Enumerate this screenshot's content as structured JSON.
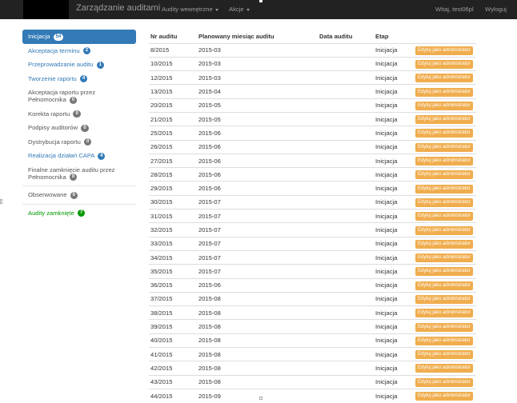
{
  "navbar": {
    "brand": "Zarządzanie auditami",
    "menu1": "Audity wewnętrzne",
    "menu2": "Akcje",
    "welcome": "Witaj, test06pl",
    "logout": "Wyloguj"
  },
  "sidebar": [
    {
      "label": "Inicjacja",
      "count": "54",
      "style": "active"
    },
    {
      "label": "Akceptacja terminu",
      "count": "2",
      "style": "blue"
    },
    {
      "label": "Przeprowadzanie auditu",
      "count": "1",
      "style": "blue"
    },
    {
      "label": "Tworzenie raportu",
      "count": "4",
      "style": "blue"
    },
    {
      "label": "Akceptacja raportu przez Pełnomocnika",
      "count": "0",
      "style": "gray"
    },
    {
      "label": "Korekta raportu",
      "count": "0",
      "style": "gray"
    },
    {
      "label": "Podpisy auditorów",
      "count": "0",
      "style": "gray"
    },
    {
      "label": "Dystrybucja raportu",
      "count": "0",
      "style": "gray"
    },
    {
      "label": "Realizacja działań CAPA",
      "count": "4",
      "style": "blue"
    },
    {
      "label": "Finalne zamknięcie auditu przez Pełnomocnika",
      "count": "0",
      "style": "gray"
    },
    {
      "label": "Obserwowane",
      "count": "0",
      "style": "gray",
      "divider_before": true
    },
    {
      "label": "Audity zamknięte",
      "count": "7",
      "style": "green",
      "divider_before": true
    }
  ],
  "table": {
    "headers": [
      "Nr auditu",
      "Planowany miesiąc auditu",
      "Data auditu",
      "Etap",
      ""
    ],
    "button_label": "Edytuj jako administrator",
    "rows": [
      [
        "8/2015",
        "2015-03",
        "",
        "Inicjacja"
      ],
      [
        "10/2015",
        "2015-03",
        "",
        "Inicjacja"
      ],
      [
        "12/2015",
        "2015-03",
        "",
        "Inicjacja"
      ],
      [
        "13/2015",
        "2015-04",
        "",
        "Inicjacja"
      ],
      [
        "20/2015",
        "2015-05",
        "",
        "Inicjacja"
      ],
      [
        "21/2015",
        "2015-05",
        "",
        "Inicjacja"
      ],
      [
        "25/2015",
        "2015-06",
        "",
        "Inicjacja"
      ],
      [
        "26/2015",
        "2015-06",
        "",
        "Inicjacja"
      ],
      [
        "27/2015",
        "2015-06",
        "",
        "Inicjacja"
      ],
      [
        "28/2015",
        "2015-06",
        "",
        "Inicjacja"
      ],
      [
        "29/2015",
        "2015-06",
        "",
        "Inicjacja"
      ],
      [
        "30/2015",
        "2015-07",
        "",
        "Inicjacja"
      ],
      [
        "31/2015",
        "2015-07",
        "",
        "Inicjacja"
      ],
      [
        "32/2015",
        "2015-07",
        "",
        "Inicjacja"
      ],
      [
        "33/2015",
        "2015-07",
        "",
        "Inicjacja"
      ],
      [
        "34/2015",
        "2015-07",
        "",
        "Inicjacja"
      ],
      [
        "35/2015",
        "2015-07",
        "",
        "Inicjacja"
      ],
      [
        "36/2015",
        "2015-06",
        "",
        "Inicjacja"
      ],
      [
        "37/2015",
        "2015-08",
        "",
        "Inicjacja"
      ],
      [
        "38/2015",
        "2015-08",
        "",
        "Inicjacja"
      ],
      [
        "39/2015",
        "2015-08",
        "",
        "Inicjacja"
      ],
      [
        "40/2015",
        "2015-08",
        "",
        "Inicjacja"
      ],
      [
        "41/2015",
        "2015-08",
        "",
        "Inicjacja"
      ],
      [
        "42/2015",
        "2015-08",
        "",
        "Inicjacja"
      ],
      [
        "43/2015",
        "2015-08",
        "",
        "Inicjacja"
      ],
      [
        "44/2015",
        "2015-09",
        "",
        "Inicjacja"
      ]
    ]
  },
  "colors": {
    "navbar": "#222222",
    "primary": "#337ab7",
    "warning": "#f0ad4e",
    "success": "#009900"
  }
}
